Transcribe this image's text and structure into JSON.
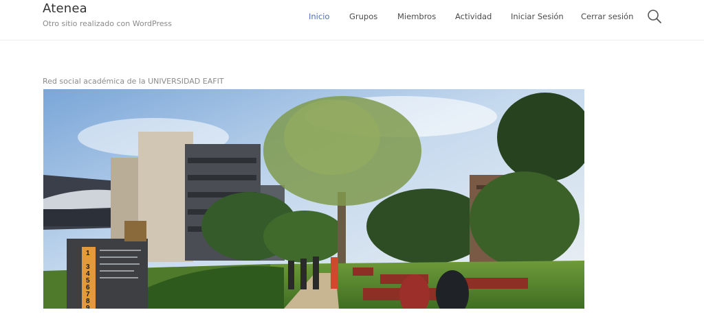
{
  "site": {
    "title": "Atenea",
    "tagline": "Otro sitio realizado con WordPress"
  },
  "nav": {
    "items": [
      "Inicio",
      "Grupos",
      "Miembros",
      "Actividad",
      "Iniciar Sesión",
      "Cerrar sesión"
    ],
    "active": "Inicio",
    "active_color": "#4a6fb5"
  },
  "search": {
    "icon": "search-icon"
  },
  "content": {
    "intro": "Red social académica de la UNIVERSIDAD EAFIT"
  },
  "hero": {
    "sign_numbers": [
      "1",
      "3",
      "4",
      "5",
      "6",
      "7",
      "8",
      "9"
    ]
  }
}
